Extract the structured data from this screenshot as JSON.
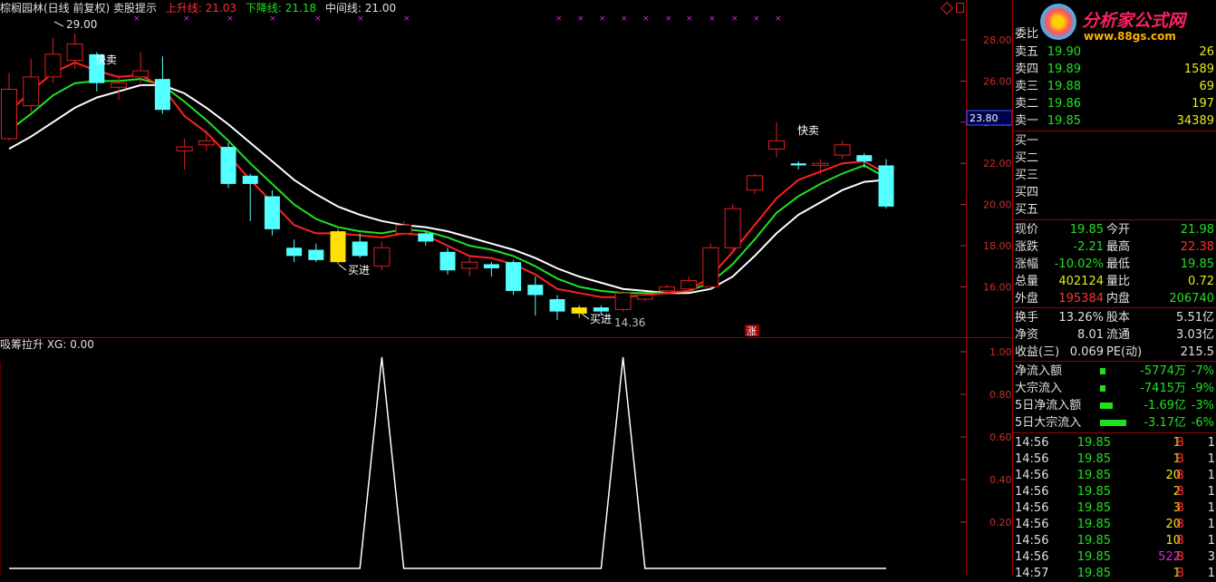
{
  "colors": {
    "up": "#e02020",
    "down": "#54ffff",
    "ma_red": "#ff2020",
    "ma_green": "#20e020",
    "ma_white": "#ffffff",
    "highlight": "#ffe000",
    "frame": "#a00000",
    "label_gray": "#c0c0c0",
    "text_yellow": "#e8e820",
    "text_green": "#20e020",
    "text_red": "#ff3030",
    "text_white": "#e0e0e0",
    "text_magenta": "#e020e0"
  },
  "header": {
    "title": "棕榈园林(日线 前复权) 卖股提示",
    "up_line": "上升线: 21.03",
    "down_line": "下降线: 21.18",
    "mid_line": "中间线: 21.00"
  },
  "indicator": {
    "title": "吸筹拉升  XG: 0.00"
  },
  "logo": {
    "name": "分析家公式网",
    "url": "www.88gs.com"
  },
  "price_axis": {
    "labels": [
      "28.00",
      "26.00",
      "24.00",
      "22.00",
      "20.00",
      "18.00",
      "16.00"
    ],
    "current": "23.80"
  },
  "ind_axis": {
    "labels": [
      "1.00",
      "0.80",
      "0.60",
      "0.40",
      "0.20"
    ]
  },
  "annotations": {
    "high": "29.00",
    "low": "14.36",
    "sell1": "快卖",
    "sell2": "快卖",
    "buy1": "买进",
    "buy2": "买进",
    "zhang": "涨"
  },
  "chart_data": {
    "type": "candlestick",
    "ylim": [
      14.5,
      30.5
    ],
    "candles": [
      {
        "o": 23.2,
        "c": 25.6,
        "h": 26.4,
        "l": 23.1
      },
      {
        "o": 24.8,
        "c": 26.2,
        "h": 27.1,
        "l": 24.5
      },
      {
        "o": 26.2,
        "c": 27.3,
        "h": 28.1,
        "l": 25.9
      },
      {
        "o": 27.0,
        "c": 27.8,
        "h": 28.3,
        "l": 26.6
      },
      {
        "o": 27.3,
        "c": 25.9,
        "h": 27.4,
        "l": 25.5
      },
      {
        "o": 25.7,
        "c": 25.9,
        "h": 26.3,
        "l": 25.1
      },
      {
        "o": 26.2,
        "c": 26.5,
        "h": 27.4,
        "l": 25.8
      },
      {
        "o": 26.1,
        "c": 24.6,
        "h": 27.2,
        "l": 24.4
      },
      {
        "o": 22.6,
        "c": 22.8,
        "h": 23.2,
        "l": 21.7
      },
      {
        "o": 22.9,
        "c": 23.1,
        "h": 23.6,
        "l": 22.6
      },
      {
        "o": 22.8,
        "c": 21.0,
        "h": 23.0,
        "l": 20.8
      },
      {
        "o": 21.4,
        "c": 21.0,
        "h": 21.5,
        "l": 19.2
      },
      {
        "o": 20.4,
        "c": 18.8,
        "h": 20.7,
        "l": 18.5
      },
      {
        "o": 17.9,
        "c": 17.5,
        "h": 18.3,
        "l": 17.2
      },
      {
        "o": 17.8,
        "c": 17.3,
        "h": 18.1,
        "l": 17.2
      },
      {
        "o": 17.2,
        "c": 18.7,
        "h": 18.8,
        "l": 17.1
      },
      {
        "o": 18.2,
        "c": 17.5,
        "h": 18.6,
        "l": 17.4
      },
      {
        "o": 17.0,
        "c": 17.9,
        "h": 18.2,
        "l": 16.8
      },
      {
        "o": 18.6,
        "c": 19.0,
        "h": 19.2,
        "l": 18.5
      },
      {
        "o": 18.6,
        "c": 18.2,
        "h": 18.7,
        "l": 18.0
      },
      {
        "o": 17.7,
        "c": 16.8,
        "h": 17.9,
        "l": 16.6
      },
      {
        "o": 16.9,
        "c": 17.2,
        "h": 17.5,
        "l": 16.5
      },
      {
        "o": 17.1,
        "c": 16.9,
        "h": 17.2,
        "l": 16.5
      },
      {
        "o": 17.2,
        "c": 15.8,
        "h": 17.3,
        "l": 15.6
      },
      {
        "o": 16.1,
        "c": 15.6,
        "h": 16.5,
        "l": 14.6
      },
      {
        "o": 15.4,
        "c": 14.8,
        "h": 15.6,
        "l": 14.4
      },
      {
        "o": 14.7,
        "c": 15.0,
        "h": 15.1,
        "l": 14.5
      },
      {
        "o": 15.0,
        "c": 14.8,
        "h": 15.1,
        "l": 14.6
      },
      {
        "o": 14.9,
        "c": 15.7,
        "h": 15.8,
        "l": 14.8
      },
      {
        "o": 15.4,
        "c": 15.6,
        "h": 15.7,
        "l": 15.3
      },
      {
        "o": 15.8,
        "c": 16.0,
        "h": 16.1,
        "l": 15.6
      },
      {
        "o": 15.9,
        "c": 16.3,
        "h": 16.5,
        "l": 15.8
      },
      {
        "o": 16.0,
        "c": 17.9,
        "h": 18.1,
        "l": 15.9
      },
      {
        "o": 17.9,
        "c": 19.8,
        "h": 20.0,
        "l": 17.8
      },
      {
        "o": 20.7,
        "c": 21.4,
        "h": 21.5,
        "l": 20.5
      },
      {
        "o": 22.7,
        "c": 23.1,
        "h": 24.0,
        "l": 22.3
      },
      {
        "o": 22.0,
        "c": 21.9,
        "h": 22.1,
        "l": 21.7
      },
      {
        "o": 21.9,
        "c": 22.0,
        "h": 22.2,
        "l": 21.5
      },
      {
        "o": 22.4,
        "c": 22.9,
        "h": 23.1,
        "l": 22.2
      },
      {
        "o": 22.4,
        "c": 22.1,
        "h": 22.5,
        "l": 21.8
      },
      {
        "o": 21.9,
        "c": 19.9,
        "h": 22.2,
        "l": 19.8
      }
    ],
    "highlight_indices": [
      15,
      26
    ],
    "ma_red": [
      24.5,
      25.5,
      26.4,
      26.9,
      26.5,
      26.2,
      26.3,
      25.7,
      24.3,
      23.5,
      22.4,
      21.2,
      20.1,
      19.0,
      18.6,
      18.6,
      18.5,
      18.4,
      18.6,
      18.5,
      18.0,
      17.5,
      17.4,
      17.1,
      16.6,
      15.9,
      15.7,
      15.5,
      15.5,
      15.6,
      15.7,
      15.8,
      16.5,
      17.7,
      19.0,
      20.3,
      21.2,
      21.6,
      22.0,
      22.1,
      21.5
    ],
    "ma_green": [
      23.6,
      24.4,
      25.3,
      25.9,
      26.0,
      26.0,
      26.1,
      25.8,
      25.0,
      24.1,
      23.1,
      22.0,
      21.0,
      20.0,
      19.3,
      18.9,
      18.7,
      18.6,
      18.8,
      18.7,
      18.4,
      18.0,
      17.8,
      17.5,
      17.0,
      16.4,
      16.0,
      15.8,
      15.7,
      15.7,
      15.7,
      15.8,
      16.2,
      17.1,
      18.3,
      19.6,
      20.4,
      21.0,
      21.5,
      21.9,
      21.3
    ],
    "ma_white": [
      22.7,
      23.3,
      24.0,
      24.7,
      25.2,
      25.5,
      25.8,
      25.8,
      25.4,
      24.7,
      23.9,
      23.0,
      22.1,
      21.2,
      20.5,
      19.9,
      19.5,
      19.2,
      19.0,
      18.9,
      18.7,
      18.4,
      18.1,
      17.8,
      17.4,
      16.9,
      16.5,
      16.2,
      15.9,
      15.8,
      15.7,
      15.7,
      15.9,
      16.5,
      17.5,
      18.6,
      19.5,
      20.1,
      20.7,
      21.1,
      21.2
    ],
    "indicator_values": [
      0,
      0,
      0,
      0,
      0,
      0,
      0,
      0,
      0,
      0,
      0,
      0,
      0,
      0,
      0,
      0,
      0,
      1,
      0,
      0,
      0,
      0,
      0,
      0,
      0,
      0,
      0,
      0,
      1,
      0,
      0,
      0,
      0,
      0,
      0,
      0,
      0,
      0,
      0,
      0,
      0
    ]
  },
  "quote": {
    "wb_label": "委比",
    "sells": [
      {
        "label": "卖五",
        "price": "19.90",
        "vol": "26"
      },
      {
        "label": "卖四",
        "price": "19.89",
        "vol": "1589"
      },
      {
        "label": "卖三",
        "price": "19.88",
        "vol": "69"
      },
      {
        "label": "卖二",
        "price": "19.86",
        "vol": "197"
      },
      {
        "label": "卖一",
        "price": "19.85",
        "vol": "34389"
      }
    ],
    "buys": [
      {
        "label": "买一"
      },
      {
        "label": "买二"
      },
      {
        "label": "买三"
      },
      {
        "label": "买四"
      },
      {
        "label": "买五"
      }
    ],
    "stats": [
      {
        "l1": "现价",
        "v1": "19.85",
        "l2": "今开",
        "v2": "21.98"
      },
      {
        "l1": "涨跌",
        "v1": "-2.21",
        "l2": "最高",
        "v2": "22.38"
      },
      {
        "l1": "涨幅",
        "v1": "-10.02%",
        "l2": "最低",
        "v2": "19.85"
      },
      {
        "l1": "总量",
        "v1": "402124",
        "l2": "量比",
        "v2": "0.72"
      },
      {
        "l1": "外盘",
        "v1": "195384",
        "l2": "内盘",
        "v2": "206740"
      }
    ],
    "stats2": [
      {
        "l1": "换手",
        "v1": "13.26%",
        "l2": "股本",
        "v2": "5.51亿"
      },
      {
        "l1": "净资",
        "v1": "8.01",
        "l2": "流通",
        "v2": "3.03亿"
      },
      {
        "l1": "收益(三)",
        "v1": "0.069",
        "l2": "PE(动)",
        "v2": "215.5"
      }
    ],
    "flows": [
      {
        "label": "净流入额",
        "value": "-5774万",
        "pct": "-7%",
        "bar": 0.1
      },
      {
        "label": "大宗流入",
        "value": "-7415万",
        "pct": "-9%",
        "bar": 0.12
      },
      {
        "label": "5日净流入额",
        "value": "-1.69亿",
        "pct": "-3%",
        "bar": 0.45
      },
      {
        "label": "5日大宗流入",
        "value": "-3.17亿",
        "pct": "-6%",
        "bar": 0.9
      }
    ],
    "ticks": [
      {
        "t": "14:56",
        "p": "19.85",
        "v": "1",
        "bs": "B",
        "n": "1"
      },
      {
        "t": "14:56",
        "p": "19.85",
        "v": "1",
        "bs": "B",
        "n": "1"
      },
      {
        "t": "14:56",
        "p": "19.85",
        "v": "20",
        "bs": "B",
        "n": "1"
      },
      {
        "t": "14:56",
        "p": "19.85",
        "v": "2",
        "bs": "B",
        "n": "1"
      },
      {
        "t": "14:56",
        "p": "19.85",
        "v": "3",
        "bs": "B",
        "n": "1"
      },
      {
        "t": "14:56",
        "p": "19.85",
        "v": "20",
        "bs": "B",
        "n": "1"
      },
      {
        "t": "14:56",
        "p": "19.85",
        "v": "10",
        "bs": "B",
        "n": "1"
      },
      {
        "t": "14:56",
        "p": "19.85",
        "v": "522",
        "bs": "B",
        "n": "3"
      },
      {
        "t": "14:57",
        "p": "19.85",
        "v": "1",
        "bs": "B",
        "n": "1"
      }
    ]
  }
}
